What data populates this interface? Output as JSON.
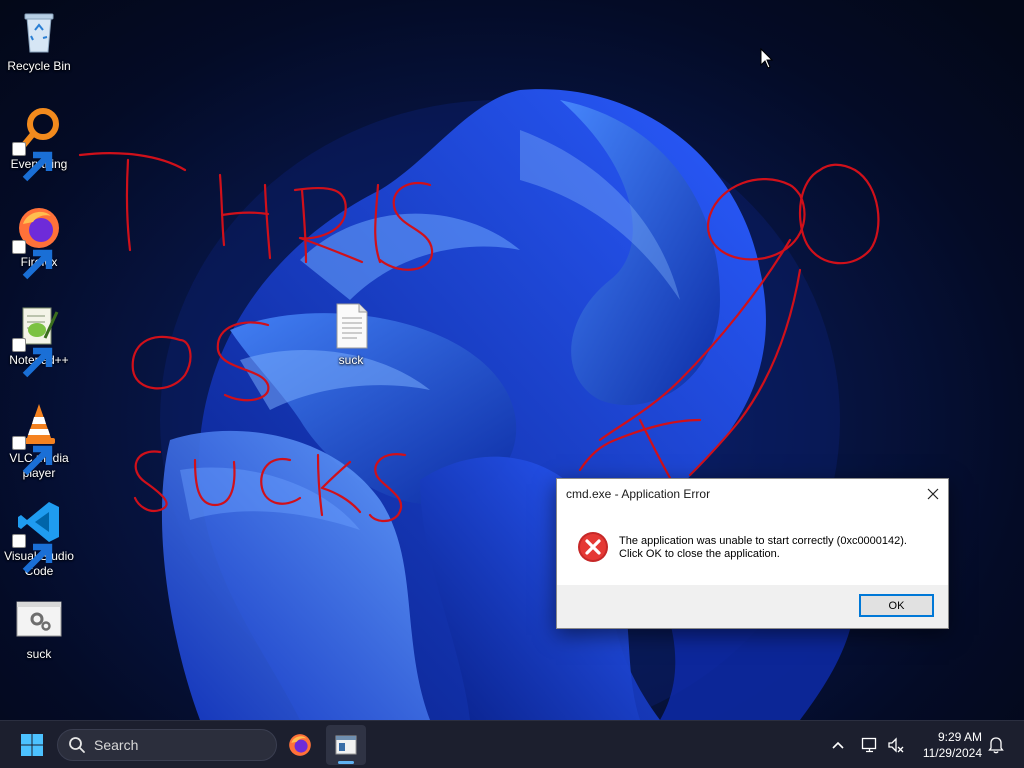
{
  "desktop": {
    "icons": [
      {
        "label": "Recycle Bin"
      },
      {
        "label": "Everything"
      },
      {
        "label": "Firefox"
      },
      {
        "label": "Notepad++"
      },
      {
        "label": "VLC media player"
      },
      {
        "label": "Visual Studio Code"
      },
      {
        "label": "suck"
      }
    ],
    "file_icon": {
      "label": "suck"
    }
  },
  "dialog": {
    "title": "cmd.exe - Application Error",
    "message_line1": "The application was unable to start correctly (0xc0000142).",
    "message_line2": "Click OK to close the application.",
    "ok_label": "OK",
    "icon": "error-icon"
  },
  "taskbar": {
    "search_label": "Search",
    "time": "9:29 AM",
    "date": "11/29/2024",
    "pinned": [
      "start-icon",
      "firefox-icon",
      "app-window-icon"
    ],
    "tray": [
      "chevron-up-icon",
      "network-icon",
      "volume-muted-icon",
      "notification-bell-icon"
    ]
  },
  "colors": {
    "accent": "#0078d7",
    "scribble": "#d0101a",
    "error_red": "#d32f2f"
  }
}
